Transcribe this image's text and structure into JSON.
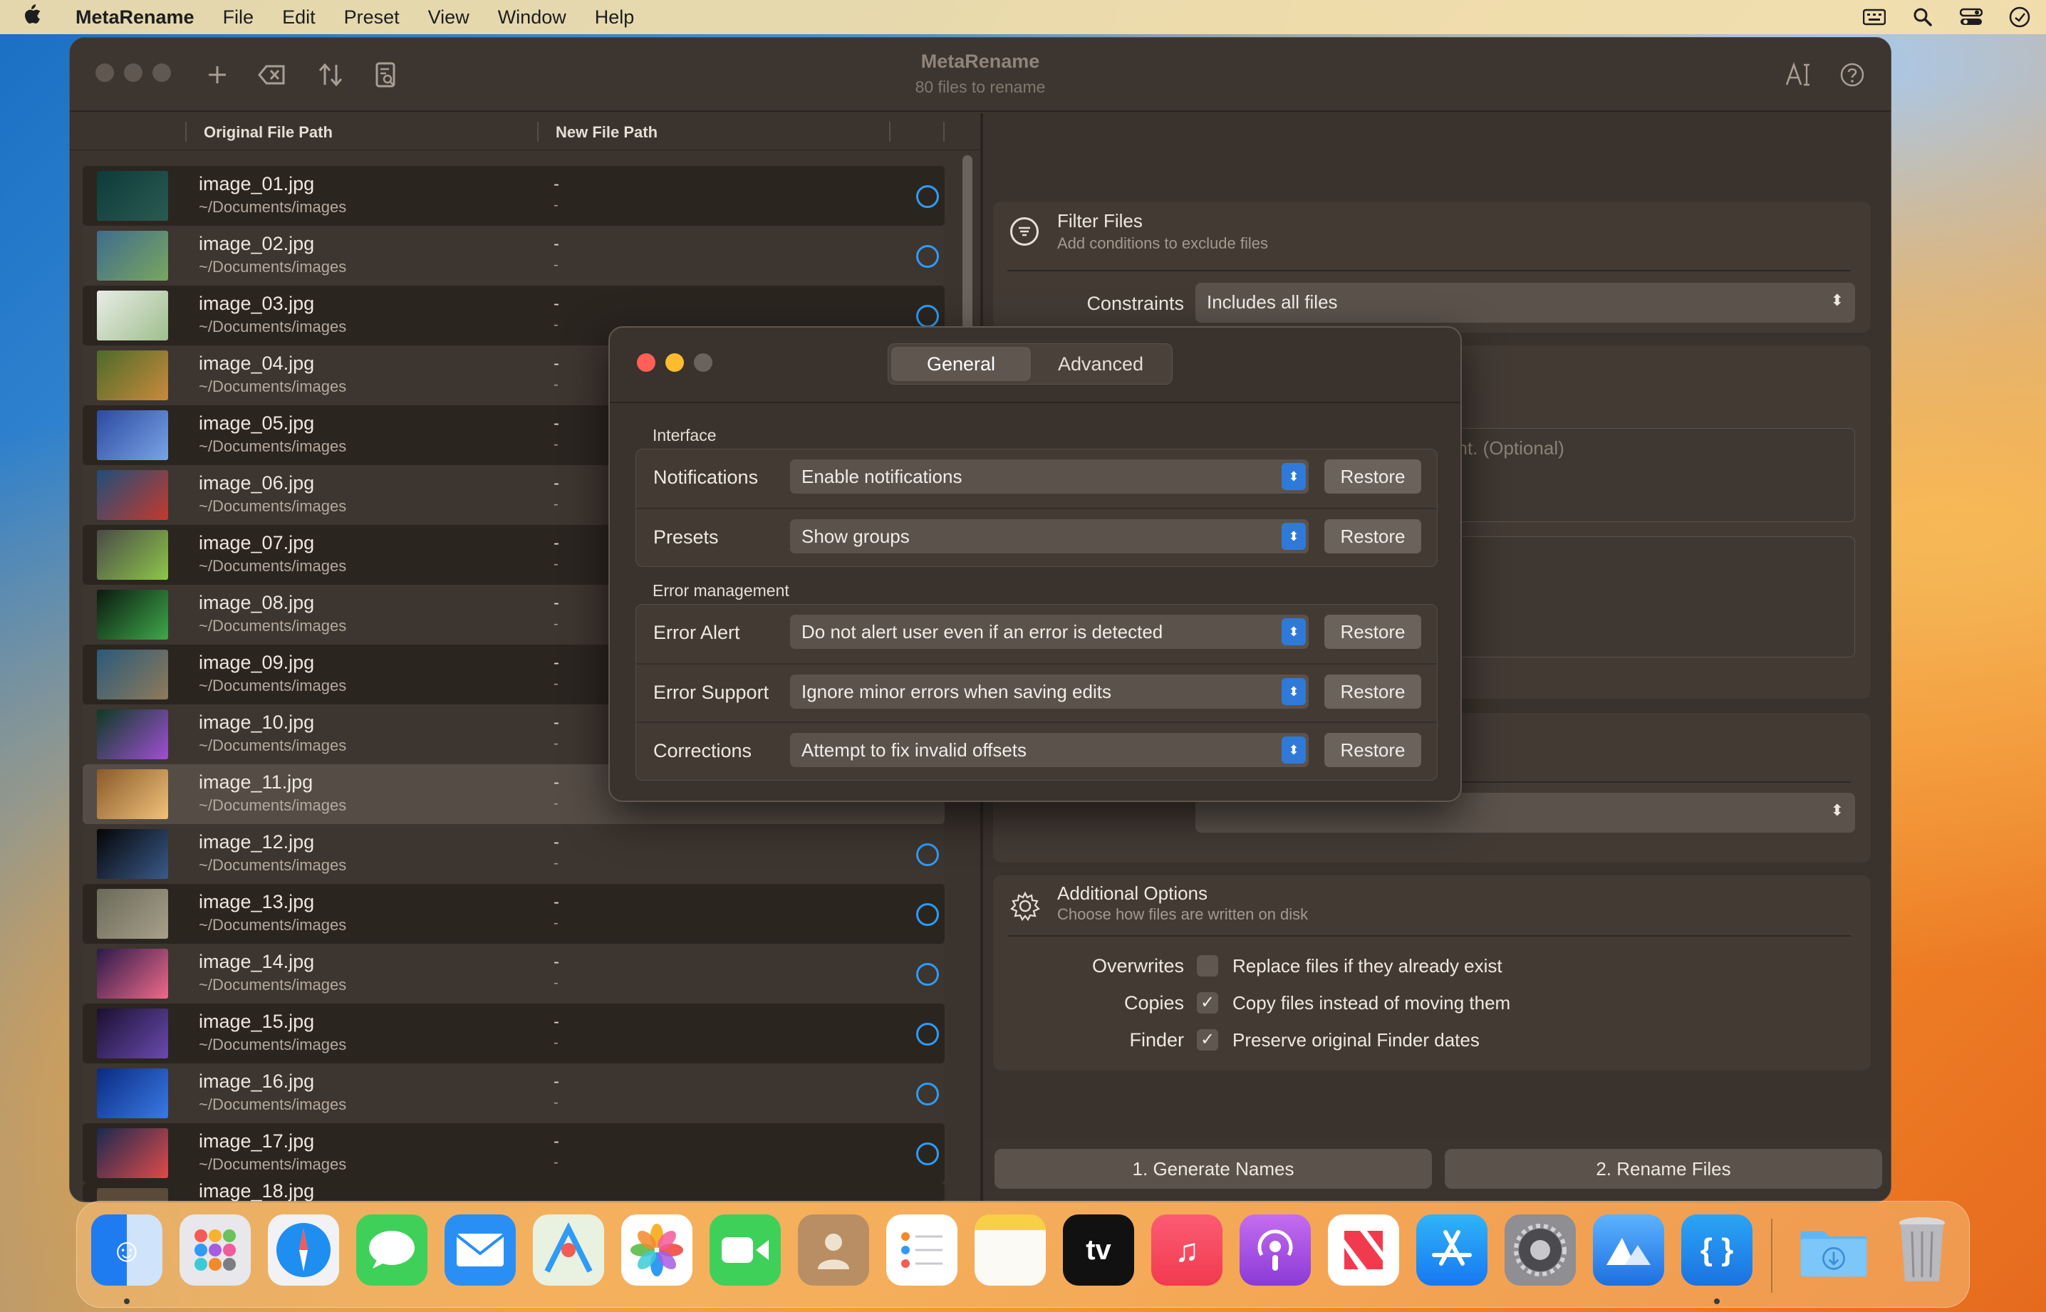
{
  "menubar": {
    "app_name": "MetaRename",
    "items": [
      "File",
      "Edit",
      "Preset",
      "View",
      "Window",
      "Help"
    ]
  },
  "window": {
    "title": "MetaRename",
    "subtitle": "80 files to rename"
  },
  "table": {
    "columns": [
      "Original File Path",
      "New File Path"
    ],
    "rows": [
      {
        "name": "image_01.jpg",
        "path": "~/Documents/images",
        "new1": "-",
        "new2": "-"
      },
      {
        "name": "image_02.jpg",
        "path": "~/Documents/images",
        "new1": "-",
        "new2": "-"
      },
      {
        "name": "image_03.jpg",
        "path": "~/Documents/images",
        "new1": "-",
        "new2": "-"
      },
      {
        "name": "image_04.jpg",
        "path": "~/Documents/images",
        "new1": "-",
        "new2": "-"
      },
      {
        "name": "image_05.jpg",
        "path": "~/Documents/images",
        "new1": "-",
        "new2": "-"
      },
      {
        "name": "image_06.jpg",
        "path": "~/Documents/images",
        "new1": "-",
        "new2": "-"
      },
      {
        "name": "image_07.jpg",
        "path": "~/Documents/images",
        "new1": "-",
        "new2": "-"
      },
      {
        "name": "image_08.jpg",
        "path": "~/Documents/images",
        "new1": "-",
        "new2": "-"
      },
      {
        "name": "image_09.jpg",
        "path": "~/Documents/images",
        "new1": "-",
        "new2": "-"
      },
      {
        "name": "image_10.jpg",
        "path": "~/Documents/images",
        "new1": "-",
        "new2": "-"
      },
      {
        "name": "image_11.jpg",
        "path": "~/Documents/images",
        "new1": "-",
        "new2": "-"
      },
      {
        "name": "image_12.jpg",
        "path": "~/Documents/images",
        "new1": "-",
        "new2": "-"
      },
      {
        "name": "image_13.jpg",
        "path": "~/Documents/images",
        "new1": "-",
        "new2": "-"
      },
      {
        "name": "image_14.jpg",
        "path": "~/Documents/images",
        "new1": "-",
        "new2": "-"
      },
      {
        "name": "image_15.jpg",
        "path": "~/Documents/images",
        "new1": "-",
        "new2": "-"
      },
      {
        "name": "image_16.jpg",
        "path": "~/Documents/images",
        "new1": "-",
        "new2": "-"
      },
      {
        "name": "image_17.jpg",
        "path": "~/Documents/images",
        "new1": "-",
        "new2": "-"
      }
    ],
    "partial_row": "image_18.jpg"
  },
  "filter": {
    "title": "Filter Files",
    "subtitle": "Add conditions to exclude files",
    "constraints_label": "Constraints",
    "constraints_value": "Includes all files"
  },
  "partial_card": {
    "placeholder_fragment": "ant. (Optional)"
  },
  "options": {
    "title": "Additional Options",
    "subtitle": "Choose how files are written on disk",
    "items": [
      {
        "label": "Overwrites",
        "text": "Replace files if they already exist",
        "checked": false
      },
      {
        "label": "Copies",
        "text": "Copy files instead of moving them",
        "checked": true
      },
      {
        "label": "Finder",
        "text": "Preserve original Finder dates",
        "checked": true
      }
    ]
  },
  "actions": {
    "generate": "1. Generate Names",
    "rename": "2. Rename Files"
  },
  "dialog": {
    "tabs": [
      "General",
      "Advanced"
    ],
    "interface_title": "Interface",
    "error_title": "Error management",
    "restore_label": "Restore",
    "interface_rows": [
      {
        "label": "Notifications",
        "value": "Enable notifications"
      },
      {
        "label": "Presets",
        "value": "Show groups"
      }
    ],
    "error_rows": [
      {
        "label": "Error Alert",
        "value": "Do not alert user even if an error is detected"
      },
      {
        "label": "Error Support",
        "value": "Ignore minor errors when saving edits"
      },
      {
        "label": "Corrections",
        "value": "Attempt to fix invalid offsets"
      }
    ]
  },
  "colors": {
    "accent": "#2f9bf5",
    "close": "#ff5f57",
    "minimize": "#febc2e",
    "stepper": "#2f7ad9"
  }
}
